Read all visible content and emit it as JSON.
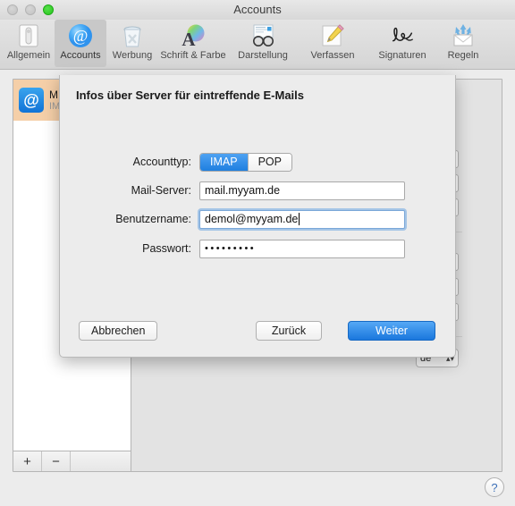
{
  "window": {
    "title": "Accounts",
    "traffic_lights": [
      "close",
      "minimize",
      "zoom"
    ]
  },
  "toolbar": {
    "items": [
      {
        "label": "Allgemein",
        "icon": "general-switch-icon",
        "selected": false
      },
      {
        "label": "Accounts",
        "icon": "at-sign-icon",
        "selected": true
      },
      {
        "label": "Werbung",
        "icon": "junk-trash-icon",
        "selected": false
      },
      {
        "label": "Schrift & Farbe",
        "icon": "font-color-icon",
        "selected": false
      },
      {
        "label": "Darstellung",
        "icon": "viewing-glasses-icon",
        "selected": false
      },
      {
        "label": "Verfassen",
        "icon": "compose-pencil-icon",
        "selected": false
      },
      {
        "label": "Signaturen",
        "icon": "signature-icon",
        "selected": false
      },
      {
        "label": "Regeln",
        "icon": "rules-envelope-icon",
        "selected": false
      }
    ]
  },
  "sidebar": {
    "accounts": [
      {
        "name": "M",
        "type": "IM",
        "icon": "mail-account-icon",
        "selected": true
      }
    ],
    "add_label": "+",
    "remove_label": "−"
  },
  "detail": {
    "popup_value": "de",
    "popup_arrows": "▴▾"
  },
  "help": {
    "label": "?"
  },
  "sheet": {
    "heading": "Infos über Server für eintreffende E-Mails",
    "fields": {
      "account_type": {
        "label": "Accounttyp:",
        "options": [
          "IMAP",
          "POP"
        ],
        "selected": "IMAP"
      },
      "mail_server": {
        "label": "Mail-Server:",
        "value": "mail.myyam.de",
        "placeholder": ""
      },
      "username": {
        "label": "Benutzername:",
        "value": "demol@myyam.de",
        "placeholder": "",
        "focused": true
      },
      "password": {
        "label": "Passwort:",
        "value": "•••••••••",
        "placeholder": ""
      }
    },
    "buttons": {
      "cancel": "Abbrechen",
      "back": "Zurück",
      "next": "Weiter"
    }
  },
  "colors": {
    "accent_blue": "#1f7fe0",
    "selection_peach": "#f5cfa8",
    "window_bg": "#ececec"
  }
}
